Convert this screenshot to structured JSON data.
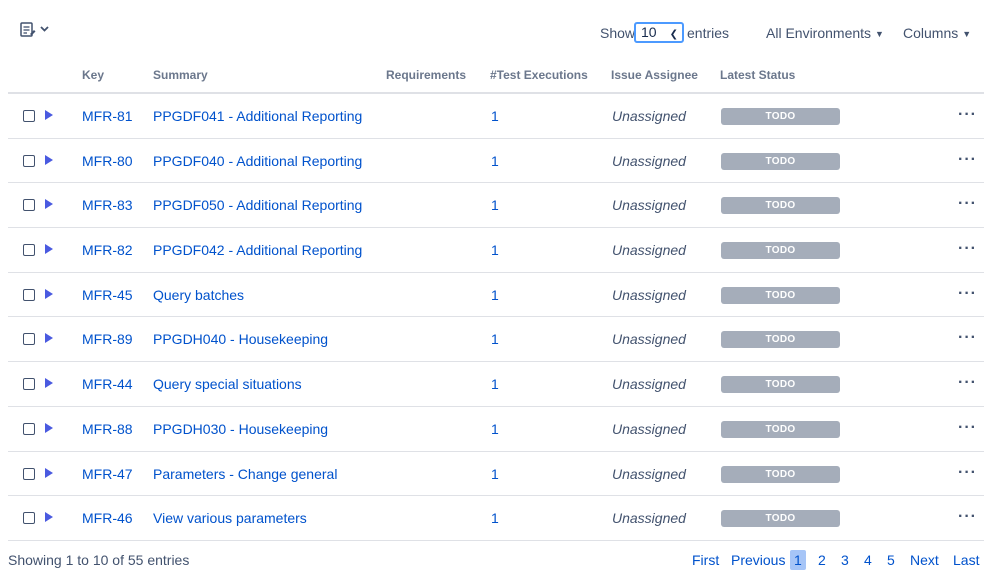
{
  "toolbar": {
    "bulk_icon": "list-edit-icon",
    "show_label": "Show",
    "page_size": "10",
    "entries_label": "entries",
    "environments_label": "All Environments",
    "columns_label": "Columns"
  },
  "columns": {
    "key": "Key",
    "summary": "Summary",
    "requirements": "Requirements",
    "test_executions": "#Test Executions",
    "assignee": "Issue Assignee",
    "latest_status": "Latest Status"
  },
  "rows": [
    {
      "key": "MFR-81",
      "summary": "PPGDF041 - Additional Reporting",
      "requirements": "",
      "executions": "1",
      "assignee": "Unassigned",
      "status": "TODO"
    },
    {
      "key": "MFR-80",
      "summary": "PPGDF040 - Additional Reporting",
      "requirements": "",
      "executions": "1",
      "assignee": "Unassigned",
      "status": "TODO"
    },
    {
      "key": "MFR-83",
      "summary": "PPGDF050 - Additional Reporting",
      "requirements": "",
      "executions": "1",
      "assignee": "Unassigned",
      "status": "TODO"
    },
    {
      "key": "MFR-82",
      "summary": "PPGDF042 - Additional Reporting",
      "requirements": "",
      "executions": "1",
      "assignee": "Unassigned",
      "status": "TODO"
    },
    {
      "key": "MFR-45",
      "summary": "Query batches",
      "requirements": "",
      "executions": "1",
      "assignee": "Unassigned",
      "status": "TODO"
    },
    {
      "key": "MFR-89",
      "summary": "PPGDH040 - Housekeeping",
      "requirements": "",
      "executions": "1",
      "assignee": "Unassigned",
      "status": "TODO"
    },
    {
      "key": "MFR-44",
      "summary": "Query special situations",
      "requirements": "",
      "executions": "1",
      "assignee": "Unassigned",
      "status": "TODO"
    },
    {
      "key": "MFR-88",
      "summary": "PPGDH030 - Housekeeping",
      "requirements": "",
      "executions": "1",
      "assignee": "Unassigned",
      "status": "TODO"
    },
    {
      "key": "MFR-47",
      "summary": "Parameters - Change general",
      "requirements": "",
      "executions": "1",
      "assignee": "Unassigned",
      "status": "TODO"
    },
    {
      "key": "MFR-46",
      "summary": "View various parameters",
      "requirements": "",
      "executions": "1",
      "assignee": "Unassigned",
      "status": "TODO"
    }
  ],
  "footer": {
    "info": "Showing 1 to 10 of 55 entries",
    "first": "First",
    "previous": "Previous",
    "pages": [
      "1",
      "2",
      "3",
      "4",
      "5"
    ],
    "current_page": "1",
    "next": "Next",
    "last": "Last"
  },
  "colors": {
    "link": "#0052cc",
    "status_todo": "#a5adba",
    "select_focus": "#4c9aff",
    "current_page_bg": "#a6c5f7",
    "test_type_icon": "#4a5ae0"
  },
  "icons": {
    "row_type": "test-play-icon",
    "row_more": "more-horizontal-icon"
  }
}
